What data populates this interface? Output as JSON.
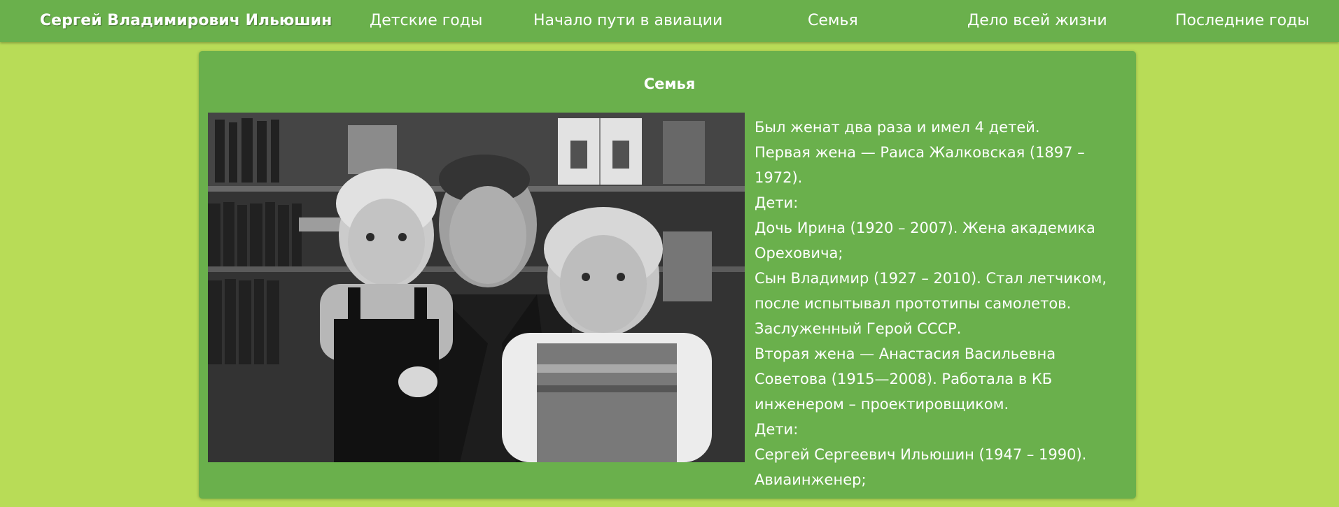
{
  "nav": {
    "brand": "Сергей Владимирович Ильюшин",
    "items": [
      {
        "label": "Детские годы"
      },
      {
        "label": "Начало пути в авиации"
      },
      {
        "label": "Семья"
      },
      {
        "label": "Дело всей жизни"
      },
      {
        "label": "Последние годы"
      }
    ]
  },
  "section": {
    "title": "Семья",
    "photo_icon": "family-photo",
    "lines": [
      "Был женат два раза и имел 4 детей.",
      "Первая жена — Раиса Жалковская (1897 –",
      "1972).",
      "Дети:",
      "Дочь Ирина (1920 – 2007). Жена академика",
      "Ореховича;",
      "Сын Владимир (1927 – 2010). Стал летчиком,",
      "после испытывал прототипы самолетов.",
      "Заслуженный Герой СССР.",
      "Вторая жена — Анастасия Васильевна",
      "Советова (1915—2008). Работала в КБ",
      "инженером – проектировщиком.",
      "Дети:",
      "Сергей Сергеевич Ильюшин (1947 – 1990).",
      "Авиаинженер;"
    ]
  },
  "colors": {
    "page_bg": "#b8dc57",
    "nav_bg": "#6ab04c",
    "card_bg": "#6ab04c",
    "text": "#ffffff"
  }
}
